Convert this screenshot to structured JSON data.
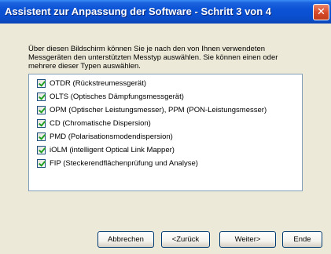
{
  "window": {
    "title": "Assistent zur Anpassung der Software - Schritt 3 von 4",
    "close_glyph": "✕"
  },
  "description": "Über diesen Bildschirm können Sie je nach den von Ihnen verwendeten Messgeräten den unterstützten Messtyp auswählen. Sie können einen oder mehrere dieser Typen auswählen.",
  "measurement_types": [
    {
      "label": "OTDR (Rückstreumessgerät)",
      "checked": true
    },
    {
      "label": "OLTS (Optisches Dämpfungsmessgerät)",
      "checked": true
    },
    {
      "label": "OPM (Optischer Leistungsmesser), PPM (PON-Leistungsmesser)",
      "checked": true
    },
    {
      "label": "CD (Chromatische Dispersion)",
      "checked": true
    },
    {
      "label": "PMD (Polarisationsmodendispersion)",
      "checked": true
    },
    {
      "label": "iOLM (intelligent Optical Link Mapper)",
      "checked": true
    },
    {
      "label": "FIP (Steckerendflächenprüfung und Analyse)",
      "checked": true
    }
  ],
  "buttons": {
    "cancel": "Abbrechen",
    "back": "<Zurück",
    "next": "Weiter>",
    "finish": "Ende"
  },
  "colors": {
    "titlebar": "#0b52d6",
    "check": "#21a121",
    "dialog_bg": "#ece9d8"
  }
}
